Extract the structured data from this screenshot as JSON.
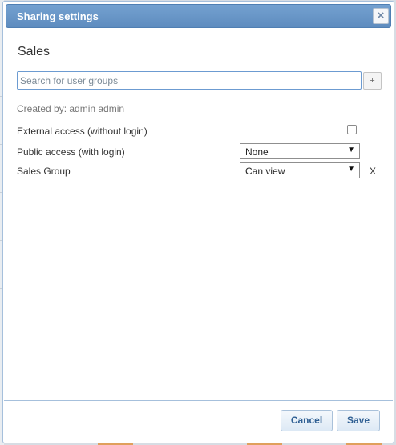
{
  "dialog": {
    "title": "Sharing settings",
    "close_label": "×",
    "heading": "Sales",
    "search_placeholder": "Search for user groups",
    "add_label": "+",
    "created_by": "Created by: admin admin",
    "external_access_label": "External access (without login)",
    "external_access_checked": false,
    "rows": [
      {
        "label": "Public access (with login)",
        "value": "None"
      },
      {
        "label": "Sales Group",
        "value": "Can view",
        "remove_label": "X"
      }
    ],
    "cancel_label": "Cancel",
    "save_label": "Save"
  },
  "colors": {
    "titlebar": "#5e8cbf",
    "button_text": "#2f5f93",
    "border": "#a6c0dc"
  }
}
